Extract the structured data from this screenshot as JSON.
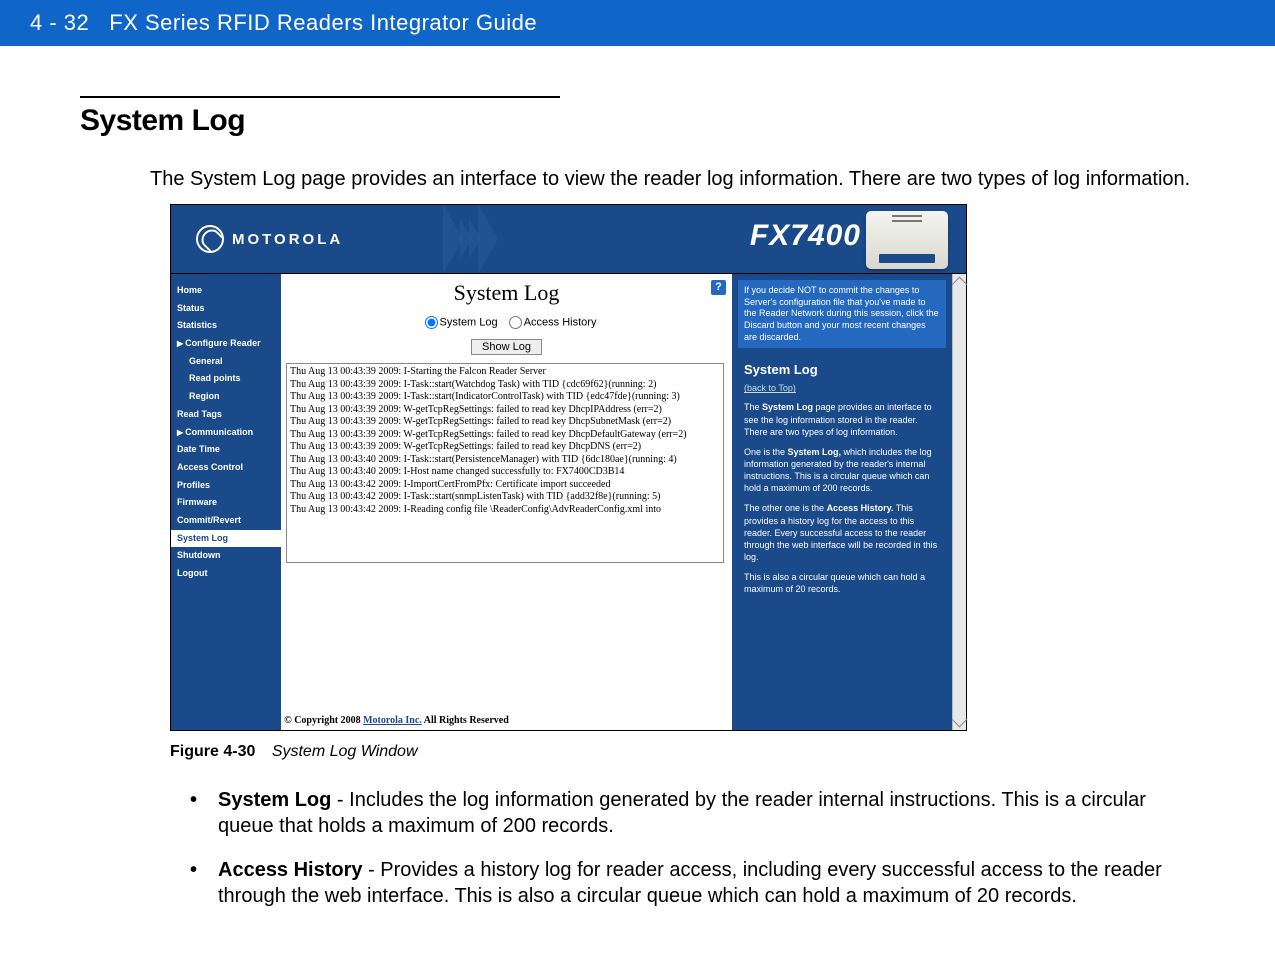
{
  "header": {
    "page_number": "4 - 32",
    "doc_title": "FX Series RFID Readers Integrator Guide"
  },
  "section": {
    "heading": "System Log",
    "intro": "The System Log page provides an interface to view the reader log information. There are two types of log information."
  },
  "screenshot": {
    "logo_text": "MOTOROLA",
    "model": "FX7400",
    "main_title": "System Log",
    "radio_system_log": "System Log",
    "radio_access_history": "Access History",
    "show_log_button": "Show Log",
    "help_icon": "?",
    "sidebar": [
      {
        "label": "Home",
        "indent": false,
        "hilite": false,
        "arrow": false
      },
      {
        "label": "Status",
        "indent": false,
        "hilite": false,
        "arrow": false
      },
      {
        "label": "Statistics",
        "indent": false,
        "hilite": false,
        "arrow": false
      },
      {
        "label": "Configure Reader",
        "indent": false,
        "hilite": false,
        "arrow": true
      },
      {
        "label": "General",
        "indent": true,
        "hilite": false,
        "arrow": false
      },
      {
        "label": "Read points",
        "indent": true,
        "hilite": false,
        "arrow": false
      },
      {
        "label": "Region",
        "indent": true,
        "hilite": false,
        "arrow": false
      },
      {
        "label": "Read Tags",
        "indent": false,
        "hilite": false,
        "arrow": false
      },
      {
        "label": "Communication",
        "indent": false,
        "hilite": false,
        "arrow": true
      },
      {
        "label": "Date Time",
        "indent": false,
        "hilite": false,
        "arrow": false
      },
      {
        "label": "Access Control",
        "indent": false,
        "hilite": false,
        "arrow": false
      },
      {
        "label": "Profiles",
        "indent": false,
        "hilite": false,
        "arrow": false
      },
      {
        "label": "Firmware",
        "indent": false,
        "hilite": false,
        "arrow": false
      },
      {
        "label": "Commit/Revert",
        "indent": false,
        "hilite": false,
        "arrow": false
      },
      {
        "label": "System Log",
        "indent": false,
        "hilite": true,
        "arrow": false
      },
      {
        "label": "Shutdown",
        "indent": false,
        "hilite": false,
        "arrow": false
      },
      {
        "label": "Logout",
        "indent": false,
        "hilite": false,
        "arrow": false
      }
    ],
    "log_lines": "Thu Aug 13 00:43:39 2009: I-Starting the Falcon Reader Server\nThu Aug 13 00:43:39 2009: I-Task::start(Watchdog Task) with TID {cdc69f62}(running: 2)\nThu Aug 13 00:43:39 2009: I-Task::start(IndicatorControlTask) with TID {edc47fde}(running: 3)\nThu Aug 13 00:43:39 2009: W-getTcpRegSettings: failed to read key DhcpIPAddress (err=2)\nThu Aug 13 00:43:39 2009: W-getTcpRegSettings: failed to read key DhcpSubnetMask (err=2)\nThu Aug 13 00:43:39 2009: W-getTcpRegSettings: failed to read key DhcpDefaultGateway (err=2)\nThu Aug 13 00:43:39 2009: W-getTcpRegSettings: failed to read key DhcpDNS (err=2)\nThu Aug 13 00:43:40 2009: I-Task::start(PersistenceManager) with TID {6dc180ae}(running: 4)\nThu Aug 13 00:43:40 2009: I-Host name changed successfully to: FX7400CD3B14\nThu Aug 13 00:43:42 2009: I-ImportCertFromPfx: Certificate import succeeded\nThu Aug 13 00:43:42 2009: I-Task::start(snmpListenTask) with TID {add32f8e}(running: 5)\nThu Aug 13 00:43:42 2009: I-Reading config file \\ReaderConfig\\AdvReaderConfig.xml into",
    "commit_box": "If you decide NOT to commit the changes to Server's configuration file that you've made to the Reader Network during this session, click the Discard button and your most recent changes are discarded.",
    "help_heading": "System Log",
    "help_back": "(back to Top)",
    "help_p1_a": "The ",
    "help_p1_b": "System Log",
    "help_p1_c": " page provides an interface to see the log information stored in the reader. There are two types of log information.",
    "help_p2_a": "One is the ",
    "help_p2_b": "System Log,",
    "help_p2_c": " which includes the log information generated by the reader's internal instructions. This is a circular queue which can hold a maximum of 200 records.",
    "help_p3_a": "The other one is the ",
    "help_p3_b": "Access History.",
    "help_p3_c": " This provides a history log for the access to this reader. Every successful access to the reader through the web interface will be recorded in this log.",
    "help_p4": "This is also a circular queue which can hold a maximum of 20 records.",
    "footer_prefix": "© Copyright 2008 ",
    "footer_link": "Motorola Inc.",
    "footer_suffix": " All Rights Reserved"
  },
  "figure": {
    "label": "Figure 4-30",
    "title": "System Log Window"
  },
  "bullets": {
    "b1_term": "System Log",
    "b1_text": " - Includes the log information generated by the reader internal instructions. This is a circular queue that holds a maximum of 200 records.",
    "b2_term": "Access History",
    "b2_text": " - Provides a history log for reader access, including every successful access to the reader through the web interface. This is also a circular queue which can hold a maximum of 20 records."
  }
}
